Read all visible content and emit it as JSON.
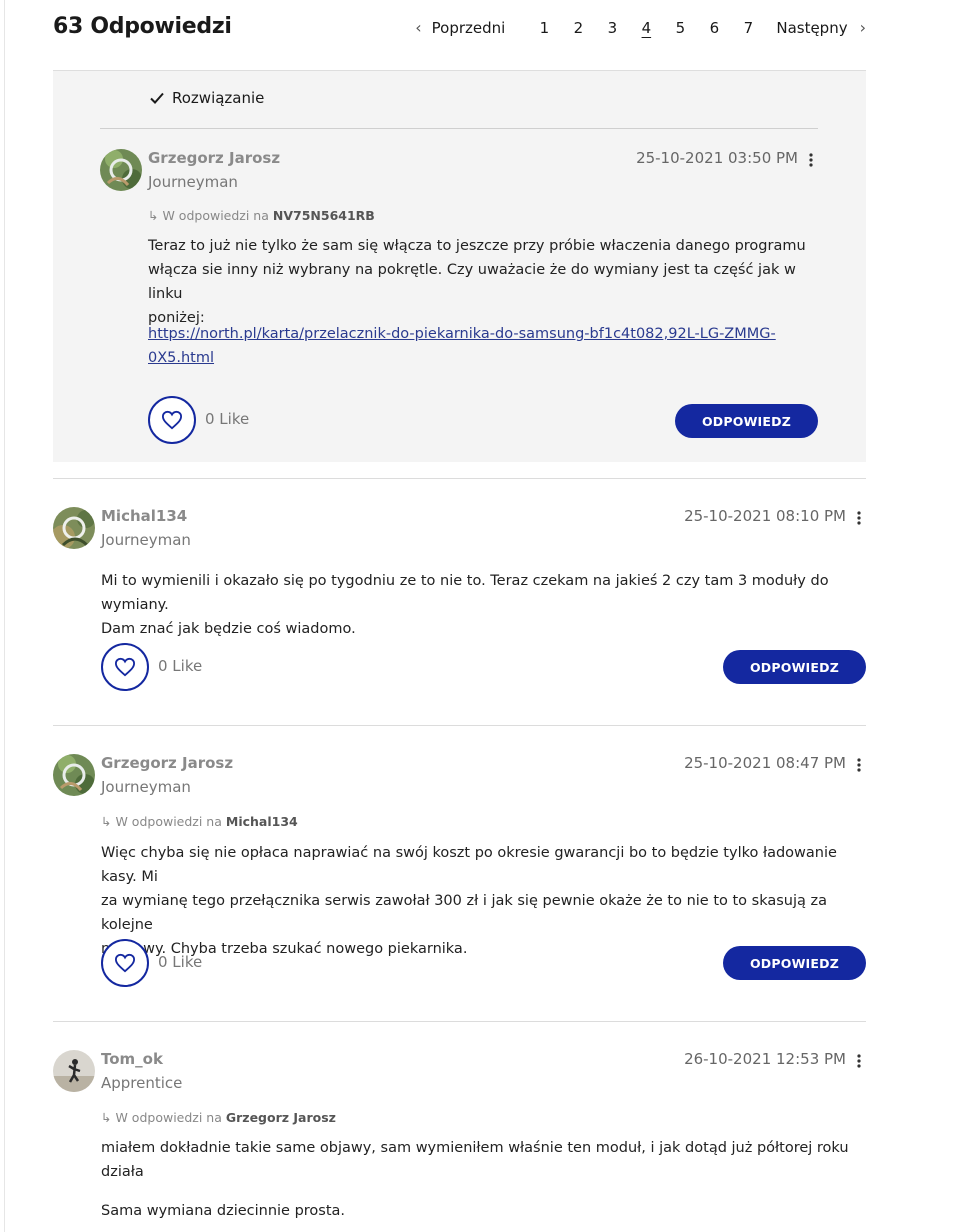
{
  "header": {
    "count_title": "63 Odpowiedzi",
    "pagination": {
      "prev_arrow": "‹",
      "prev_label": "Poprzedni",
      "pages": [
        "1",
        "2",
        "3",
        "4",
        "5",
        "6",
        "7"
      ],
      "current_page": "4",
      "next_label": "Następny",
      "next_arrow": "›"
    }
  },
  "solution": {
    "label": "Rozwiązanie",
    "post": {
      "author": "Grzegorz Jarosz",
      "rank": "Journeyman",
      "date": "25-10-2021 03:50 PM",
      "reply_prefix": "W odpowiedzi na",
      "reply_to": "NV75N5641RB",
      "body_lines": [
        "Teraz to już nie tylko że sam się włącza to jeszcze przy próbie właczenia danego programu",
        "włącza sie inny niż wybrany na pokrętle. Czy uważacie że do wymiany jest ta część jak w linku",
        "poniżej:"
      ],
      "link_lines": [
        "https://north.pl/karta/przelacznik-do-piekarnika-do-samsung-bf1c4t082,92L-LG-ZMMG-",
        "0X5.html"
      ],
      "like_count": "0 Like",
      "reply_button": "ODPOWIEDZ"
    }
  },
  "posts": [
    {
      "author": "Michal134",
      "rank": "Journeyman",
      "date": "25-10-2021 08:10 PM",
      "body_lines": [
        "Mi to wymienili i okazało się po tygodniu ze to nie to. Teraz czekam na jakieś 2 czy tam 3 moduły do wymiany.",
        "Dam znać jak będzie coś wiadomo."
      ],
      "like_count": "0 Like",
      "reply_button": "ODPOWIEDZ"
    },
    {
      "author": "Grzegorz Jarosz",
      "rank": "Journeyman",
      "date": "25-10-2021 08:47 PM",
      "reply_prefix": "W odpowiedzi na",
      "reply_to": "Michal134",
      "body_lines": [
        "Więc chyba się nie opłaca naprawiać na swój koszt po okresie gwarancji bo to będzie tylko ładowanie kasy. Mi",
        "za wymianę tego przełącznika serwis zawołał 300 zł i jak się pewnie okaże że to nie to to skasują za kolejne",
        "naprawy. Chyba trzeba szukać nowego piekarnika."
      ],
      "like_count": "0 Like",
      "reply_button": "ODPOWIEDZ"
    },
    {
      "author": "Tom_ok",
      "rank": "Apprentice",
      "date": "26-10-2021 12:53 PM",
      "reply_prefix": "W odpowiedzi na",
      "reply_to": "Grzegorz Jarosz",
      "body_lines": [
        "miałem dokładnie takie same objawy, sam wymieniłem właśnie ten moduł, i jak dotąd już półtorej roku",
        "działa"
      ],
      "body_extra": "Sama wymiana dziecinnie prosta."
    }
  ],
  "colors": {
    "accent": "#1428a0",
    "solution_bg": "#f4f4f4",
    "link": "#2a3a8f"
  },
  "icons": [
    "check-icon",
    "heart-icon",
    "more-vertical-icon",
    "reply-arrow-icon",
    "chevron-left-icon",
    "chevron-right-icon"
  ]
}
